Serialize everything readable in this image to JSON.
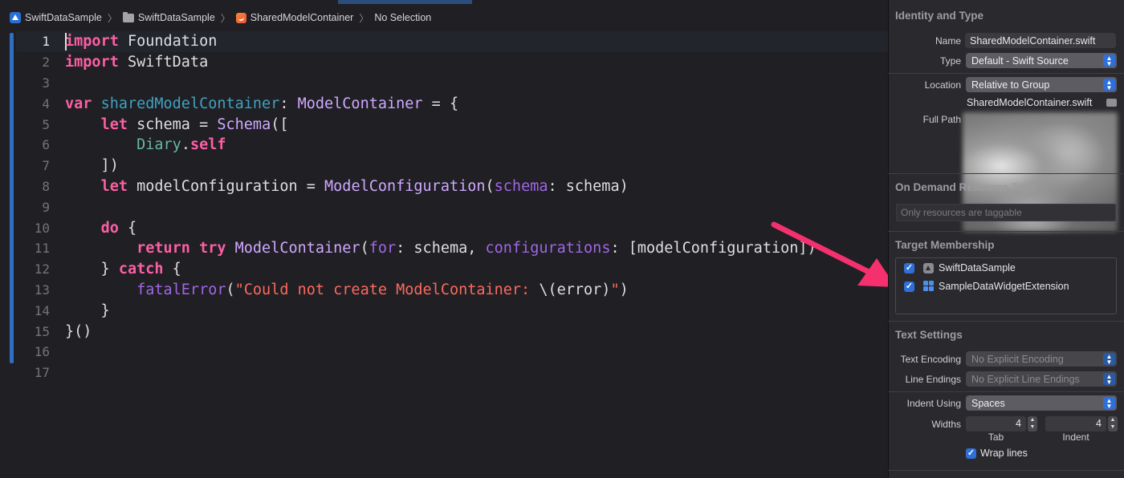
{
  "jumpbar": {
    "items": [
      {
        "label": "SwiftDataSample",
        "icon": "app-project-icon"
      },
      {
        "label": "SwiftDataSample",
        "icon": "folder-icon"
      },
      {
        "label": "SharedModelContainer",
        "icon": "swift-file-icon"
      },
      {
        "label": "No Selection",
        "icon": ""
      }
    ],
    "separator": "〉"
  },
  "editor": {
    "current_line": 1,
    "line_numbers": [
      "1",
      "2",
      "3",
      "4",
      "5",
      "6",
      "7",
      "8",
      "9",
      "10",
      "11",
      "12",
      "13",
      "14",
      "15",
      "16",
      "17"
    ],
    "lines": [
      [
        [
          "k",
          "import"
        ],
        [
          "pl",
          " Foundation"
        ]
      ],
      [
        [
          "k",
          "import"
        ],
        [
          "pl",
          " SwiftData"
        ]
      ],
      [],
      [
        [
          "k",
          "var"
        ],
        [
          "pl",
          " "
        ],
        [
          "p",
          "sharedModelContainer"
        ],
        [
          "pl",
          ": "
        ],
        [
          "t",
          "ModelContainer"
        ],
        [
          "pl",
          " = {"
        ]
      ],
      [
        [
          "pl",
          "    "
        ],
        [
          "k",
          "let"
        ],
        [
          "pl",
          " schema = "
        ],
        [
          "t",
          "Schema"
        ],
        [
          "pl",
          "(["
        ]
      ],
      [
        [
          "pl",
          "        "
        ],
        [
          "f",
          "Diary"
        ],
        [
          "pl",
          "."
        ],
        [
          "k",
          "self"
        ]
      ],
      [
        [
          "pl",
          "    ])"
        ]
      ],
      [
        [
          "pl",
          "    "
        ],
        [
          "k",
          "let"
        ],
        [
          "pl",
          " modelConfiguration = "
        ],
        [
          "t",
          "ModelConfiguration"
        ],
        [
          "pl",
          "("
        ],
        [
          "m",
          "schema"
        ],
        [
          "pl",
          ": schema)"
        ]
      ],
      [],
      [
        [
          "pl",
          "    "
        ],
        [
          "k",
          "do"
        ],
        [
          "pl",
          " {"
        ]
      ],
      [
        [
          "pl",
          "        "
        ],
        [
          "k",
          "return"
        ],
        [
          "pl",
          " "
        ],
        [
          "k",
          "try"
        ],
        [
          "pl",
          " "
        ],
        [
          "t",
          "ModelContainer"
        ],
        [
          "pl",
          "("
        ],
        [
          "m",
          "for"
        ],
        [
          "pl",
          ": schema, "
        ],
        [
          "m",
          "configurations"
        ],
        [
          "pl",
          ": [modelConfiguration])"
        ]
      ],
      [
        [
          "pl",
          "    } "
        ],
        [
          "k",
          "catch"
        ],
        [
          "pl",
          " {"
        ]
      ],
      [
        [
          "pl",
          "        "
        ],
        [
          "m",
          "fatalError"
        ],
        [
          "pl",
          "("
        ],
        [
          "s",
          "\"Could not create ModelContainer: "
        ],
        [
          "pl",
          "\\(error)"
        ],
        [
          "s",
          "\""
        ],
        [
          "pl",
          ")"
        ]
      ],
      [
        [
          "pl",
          "    }"
        ]
      ],
      [
        [
          "pl",
          "}()"
        ]
      ],
      [],
      []
    ]
  },
  "inspector": {
    "identity": {
      "title": "Identity and Type",
      "name_label": "Name",
      "name_value": "SharedModelContainer.swift",
      "type_label": "Type",
      "type_value": "Default - Swift Source",
      "location_label": "Location",
      "location_value": "Relative to Group",
      "location_path": "SharedModelContainer.swift",
      "full_path_label": "Full Path"
    },
    "on_demand": {
      "title": "On Demand Resource Tags",
      "placeholder": "Only resources are taggable"
    },
    "membership": {
      "title": "Target Membership",
      "targets": [
        {
          "label": "SwiftDataSample",
          "checked": true,
          "icon": "app-target-icon"
        },
        {
          "label": "SampleDataWidgetExtension",
          "checked": true,
          "icon": "widget-extension-icon"
        }
      ]
    },
    "text_settings": {
      "title": "Text Settings",
      "encoding_label": "Text Encoding",
      "encoding_value": "No Explicit Encoding",
      "line_endings_label": "Line Endings",
      "line_endings_value": "No Explicit Line Endings",
      "indent_using_label": "Indent Using",
      "indent_using_value": "Spaces",
      "widths_label": "Widths",
      "tab_value": "4",
      "indent_value": "4",
      "tab_label": "Tab",
      "indent_label": "Indent",
      "wrap_lines_label": "Wrap lines",
      "wrap_lines_checked": true
    }
  },
  "colors": {
    "keyword": "#fc5fa3",
    "type": "#d0a8ff",
    "property": "#41a1c0",
    "project_type": "#67b7a4",
    "method": "#a167e6",
    "string": "#fc6a5d",
    "annotation_arrow": "#f5306f",
    "accent": "#2f6fd9"
  }
}
